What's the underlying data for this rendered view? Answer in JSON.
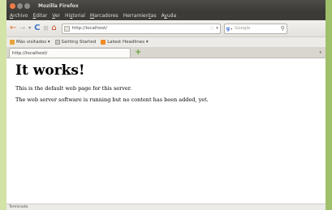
{
  "window": {
    "title": "Mozilla Firefox"
  },
  "menubar": {
    "items": [
      {
        "pre": "",
        "ul": "A",
        "post": "rchivo"
      },
      {
        "pre": "",
        "ul": "E",
        "post": "ditar"
      },
      {
        "pre": "",
        "ul": "V",
        "post": "er"
      },
      {
        "pre": "Hi",
        "ul": "s",
        "post": "torial"
      },
      {
        "pre": "",
        "ul": "M",
        "post": "arcadores"
      },
      {
        "pre": "Herramien",
        "ul": "t",
        "post": "as"
      },
      {
        "pre": "A",
        "ul": "y",
        "post": "uda"
      }
    ]
  },
  "navbar": {
    "back_icon": "←",
    "forward_icon": "→",
    "history_drop_icon": "▾",
    "reload_icon": "C",
    "stop_icon": "⦻",
    "home_icon": "⌂",
    "url": "http://localhost/",
    "bookmark_star": "☆",
    "url_drop": "▾",
    "search_engine_icon": "g",
    "search_engine_drop": "▾",
    "search_placeholder": "Google",
    "search_icon": "⚲"
  },
  "bookmarks": [
    {
      "label": "Más visitados ▾",
      "icon": "folder"
    },
    {
      "label": "Getting Started",
      "icon": "page"
    },
    {
      "label": "Latest Headlines ▾",
      "icon": "rss"
    }
  ],
  "tabs": [
    {
      "label": "http://localhost/"
    }
  ],
  "tabbar": {
    "new_tab_icon": "+",
    "tab_list_icon": "▾"
  },
  "page": {
    "heading": "It works!",
    "paragraphs": [
      "This is the default web page for this server.",
      "The web server software is running but no content has been added, yet."
    ]
  },
  "status": {
    "text": "Terminado"
  },
  "colors": {
    "backdrop": "#d3e3a8",
    "titlebar": "#3c3b37",
    "close_button": "#f07a46",
    "back_arrow": "#e2702e",
    "reload": "#3f77c8"
  }
}
